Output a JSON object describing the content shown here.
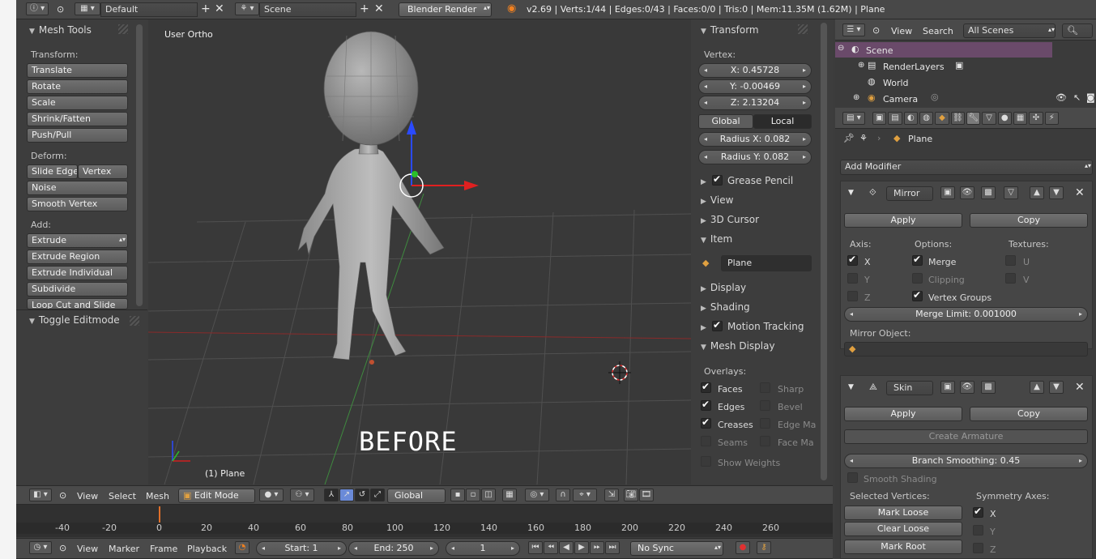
{
  "top": {
    "layout": "Default",
    "scene": "Scene",
    "engine": "Blender Render",
    "stats": "v2.69 | Verts:1/44 | Edges:0/43 | Faces:0/0 | Tris:0 | Mem:11.35M (1.62M) | Plane"
  },
  "tools": {
    "title": "Mesh Tools",
    "transform_label": "Transform:",
    "transform": [
      "Translate",
      "Rotate",
      "Scale",
      "Shrink/Fatten",
      "Push/Pull"
    ],
    "deform_label": "Deform:",
    "slide_edge": "Slide Edge",
    "vertex": "Vertex",
    "noise": "Noise",
    "smooth_vertex": "Smooth Vertex",
    "add_label": "Add:",
    "add": [
      "Extrude",
      "Extrude Region",
      "Extrude Individual",
      "Subdivide",
      "Loop Cut and Slide"
    ],
    "toggle": "Toggle Editmode"
  },
  "viewport": {
    "view_name": "User Ortho",
    "object_label": "(1) Plane",
    "annotation": "BEFORE"
  },
  "npanel": {
    "transform": "Transform",
    "vertex_label": "Vertex:",
    "x": "X: 0.45728",
    "y": "Y: -0.00469",
    "z": "Z: 2.13204",
    "global": "Global",
    "local": "Local",
    "radius_x": "Radius X: 0.082",
    "radius_y": "Radius Y: 0.082",
    "grease": "Grease Pencil",
    "view": "View",
    "cursor": "3D Cursor",
    "item": "Item",
    "item_name": "Plane",
    "display": "Display",
    "shading": "Shading",
    "motion": "Motion Tracking",
    "mesh_display": "Mesh Display",
    "overlays": "Overlays:",
    "faces": "Faces",
    "sharp": "Sharp",
    "edges": "Edges",
    "bevel": "Bevel",
    "creases": "Creases",
    "face_ma": "Face Ma",
    "edge_ma": "Edge Ma",
    "seams": "Seams",
    "show_weights": "Show Weights"
  },
  "outliner": {
    "view": "View",
    "search": "Search",
    "all_scenes": "All Scenes",
    "items": [
      "Scene",
      "RenderLayers",
      "World",
      "Camera"
    ]
  },
  "props": {
    "object": "Plane",
    "add_modifier": "Add Modifier",
    "mirror": {
      "name": "Mirror",
      "apply": "Apply",
      "copy": "Copy",
      "axis": "Axis:",
      "options": "Options:",
      "textures": "Textures:",
      "x": "X",
      "y": "Y",
      "z": "Z",
      "merge": "Merge",
      "clipping": "Clipping",
      "vertex_groups": "Vertex Groups",
      "u": "U",
      "v": "V",
      "merge_limit": "Merge Limit: 0.001000",
      "mirror_object": "Mirror Object:"
    },
    "skin": {
      "name": "Skin",
      "apply": "Apply",
      "copy": "Copy",
      "create_armature": "Create Armature",
      "branch": "Branch Smoothing: 0.45",
      "smooth_shading": "Smooth Shading",
      "selected": "Selected Vertices:",
      "symmetry": "Symmetry Axes:",
      "mark_loose": "Mark Loose",
      "clear_loose": "Clear Loose",
      "mark_root": "Mark Root",
      "x": "X",
      "y": "Y",
      "z": "Z"
    }
  },
  "view3d_header": {
    "view": "View",
    "select": "Select",
    "mesh": "Mesh",
    "mode": "Edit Mode",
    "orientation": "Global"
  },
  "timeline": {
    "ticks": [
      "-40",
      "-20",
      "0",
      "20",
      "40",
      "60",
      "80",
      "100",
      "120",
      "140",
      "160",
      "180",
      "200",
      "220",
      "240",
      "260"
    ],
    "view": "View",
    "marker": "Marker",
    "frame": "Frame",
    "playback": "Playback",
    "start": "Start: 1",
    "end": "End: 250",
    "current": "1",
    "sync": "No Sync"
  }
}
